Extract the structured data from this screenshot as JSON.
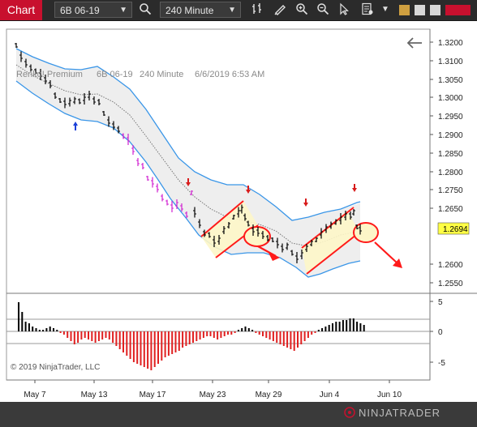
{
  "window": {
    "title": "Chart",
    "instrument": "6B 06-19",
    "interval": "240 Minute",
    "logo": "NINJATRADER"
  },
  "chart": {
    "info_label": "Renko! Premium",
    "instrument_text": "6B 06-19",
    "interval_text": "240 Minute",
    "datetime_text": "6/6/2019 6:53 AM",
    "copyright": "© 2019 NinjaTrader, LLC",
    "price_ticks": [
      "1.3200",
      "1.3100",
      "1.3050",
      "1.3000",
      "1.2950",
      "1.2900",
      "1.2850",
      "1.2800",
      "1.2750",
      "1.2650",
      "1.2600",
      "1.2550"
    ],
    "current_price": "1.2694",
    "osc_ticks": [
      "5",
      "0",
      "-5"
    ],
    "date_ticks": [
      "May 7",
      "May 13",
      "May 17",
      "May 23",
      "May 29",
      "Jun 4",
      "Jun 10"
    ]
  },
  "colors": {
    "bg": "#ffffff",
    "band": "#3a96e8",
    "up": "#000000",
    "down_magenta": "#d020d0",
    "osc_pos": "#000000",
    "osc_neg": "#e02020",
    "annotation": "#ff1a1a",
    "channel_fill": "#fdf6c8",
    "price_badge": "#ffff44"
  }
}
